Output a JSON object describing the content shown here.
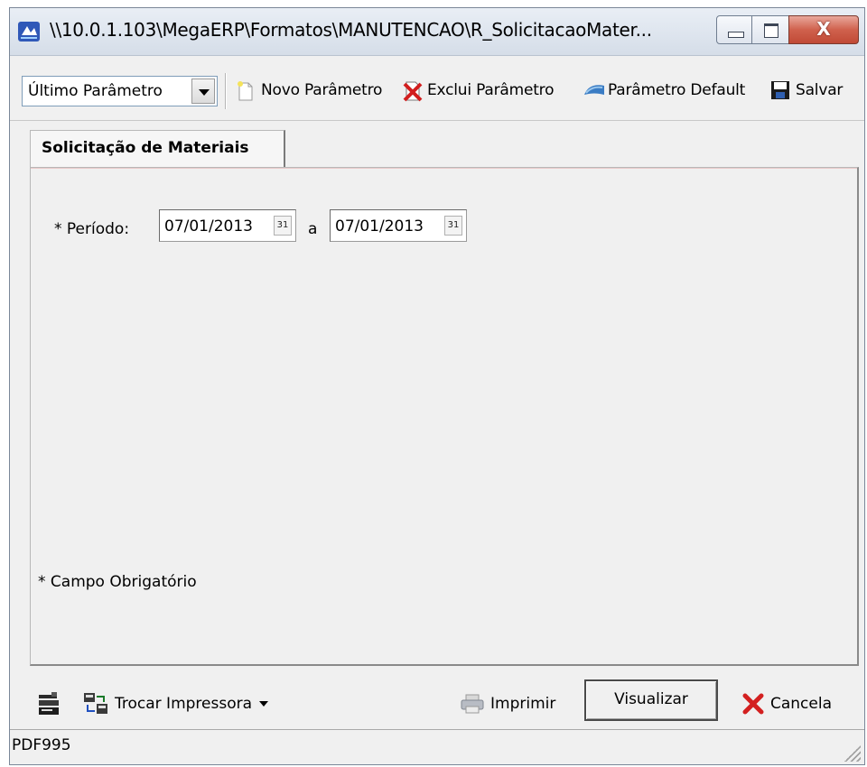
{
  "window": {
    "title": "\\\\10.0.1.103\\MegaERP\\Formatos\\MANUTENCAO\\R_SolicitacaoMater...",
    "close_glyph": "X"
  },
  "toolbar": {
    "param_select": "Último Parâmetro",
    "novo": "Novo Parâmetro",
    "exclui": "Exclui Parâmetro",
    "default": "Parâmetro Default",
    "salvar": "Salvar"
  },
  "tab": {
    "label": "Solicitação de Materiais"
  },
  "form": {
    "periodo_label": "* Período:",
    "date_from": "07/01/2013",
    "date_sep": "a",
    "date_to": "07/01/2013",
    "calendar_glyph": "31",
    "required_note": "* Campo Obrigatório"
  },
  "bottom": {
    "trocar_impressora": "Trocar Impressora",
    "imprimir": "Imprimir",
    "visualizar": "Visualizar",
    "cancela": "Cancela"
  },
  "status": {
    "printer": "PDF995"
  },
  "icons": {
    "app": "app-icon",
    "novo": "new-document-icon",
    "exclui": "delete-document-icon",
    "default": "default-param-icon",
    "salvar": "floppy-disk-icon",
    "printer_setup": "printer-setup-icon",
    "swap_printer": "swap-printer-icon",
    "imprimir": "printer-icon",
    "cancela": "red-x-icon"
  },
  "colors": {
    "window_bg": "#f0f0f0",
    "title_close": "#c8503c",
    "cancel_x": "#d32020"
  }
}
